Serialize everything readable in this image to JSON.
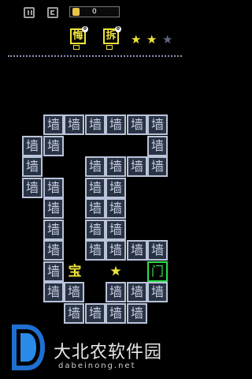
{
  "topbar": {
    "coin_count": "0",
    "tool_regret": "悔",
    "tool_demolish": "拆",
    "tool_regret_badge": "0",
    "tool_demolish_badge": "0",
    "stars_earned": 2,
    "stars_total": 3,
    "star_filled_color": "#f0e43a",
    "star_empty_color": "#5d6680"
  },
  "board": {
    "wall_label": "墙",
    "treasure_label": "宝",
    "player_label": "★",
    "door_label": "门",
    "door_color": "#2fe04a",
    "accent_color": "#f0e43a"
  },
  "watermark": {
    "title": "大北农软件园",
    "domain": "dabeinong.net"
  }
}
